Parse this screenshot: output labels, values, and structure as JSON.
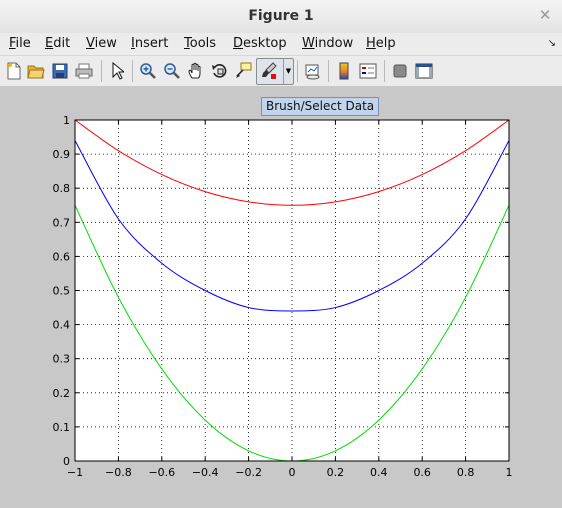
{
  "window": {
    "title": "Figure 1",
    "close_glyph": "✕"
  },
  "menu": [
    {
      "label": "File",
      "mnemonic": "F",
      "rest": "ile"
    },
    {
      "label": "Edit",
      "mnemonic": "E",
      "rest": "dit"
    },
    {
      "label": "View",
      "mnemonic": "V",
      "rest": "iew"
    },
    {
      "label": "Insert",
      "mnemonic": "I",
      "rest": "nsert"
    },
    {
      "label": "Tools",
      "mnemonic": "T",
      "rest": "ools"
    },
    {
      "label": "Desktop",
      "mnemonic": "D",
      "rest": "esktop"
    },
    {
      "label": "Window",
      "mnemonic": "W",
      "rest": "indow"
    },
    {
      "label": "Help",
      "mnemonic": "H",
      "rest": "elp"
    }
  ],
  "toolbar": {
    "tools": [
      "new-figure-icon",
      "open-file-icon",
      "save-icon",
      "print-icon",
      "edit-plot-icon",
      "zoom-in-icon",
      "zoom-out-icon",
      "pan-icon",
      "rotate-3d-icon",
      "data-cursor-icon",
      "brush-icon",
      "link-plot-icon",
      "colorbar-icon",
      "legend-icon",
      "hide-plot-tools-icon",
      "show-plot-tools-icon"
    ]
  },
  "tooltip": "Brush/Select Data",
  "chart_data": {
    "type": "line",
    "title": "",
    "xlabel": "",
    "ylabel": "",
    "xlim": [
      -1,
      1
    ],
    "ylim": [
      0,
      1
    ],
    "grid": true,
    "x_ticks": [
      "-1",
      "-0.8",
      "-0.6",
      "-0.4",
      "-0.2",
      "0",
      "0.2",
      "0.4",
      "0.6",
      "0.8",
      "1"
    ],
    "y_ticks": [
      "0",
      "0.1",
      "0.2",
      "0.3",
      "0.4",
      "0.5",
      "0.6",
      "0.7",
      "0.8",
      "0.9",
      "1"
    ],
    "series": [
      {
        "color": "#ff0000",
        "x": [
          -1,
          -0.8,
          -0.6,
          -0.4,
          -0.2,
          0,
          0.2,
          0.4,
          0.6,
          0.8,
          1
        ],
        "y": [
          1.0,
          0.91,
          0.84,
          0.79,
          0.76,
          0.75,
          0.76,
          0.79,
          0.84,
          0.91,
          1.0
        ]
      },
      {
        "color": "#0000ff",
        "x": [
          -1,
          -0.8,
          -0.6,
          -0.4,
          -0.2,
          0,
          0.2,
          0.4,
          0.6,
          0.8,
          1
        ],
        "y": [
          0.94,
          0.71,
          0.58,
          0.5,
          0.45,
          0.44,
          0.45,
          0.5,
          0.58,
          0.71,
          0.94
        ]
      },
      {
        "color": "#00dd00",
        "x": [
          -1,
          -0.8,
          -0.6,
          -0.4,
          -0.2,
          0,
          0.2,
          0.4,
          0.6,
          0.8,
          1
        ],
        "y": [
          0.75,
          0.48,
          0.27,
          0.12,
          0.03,
          0,
          0.03,
          0.12,
          0.27,
          0.48,
          0.75
        ]
      }
    ]
  }
}
